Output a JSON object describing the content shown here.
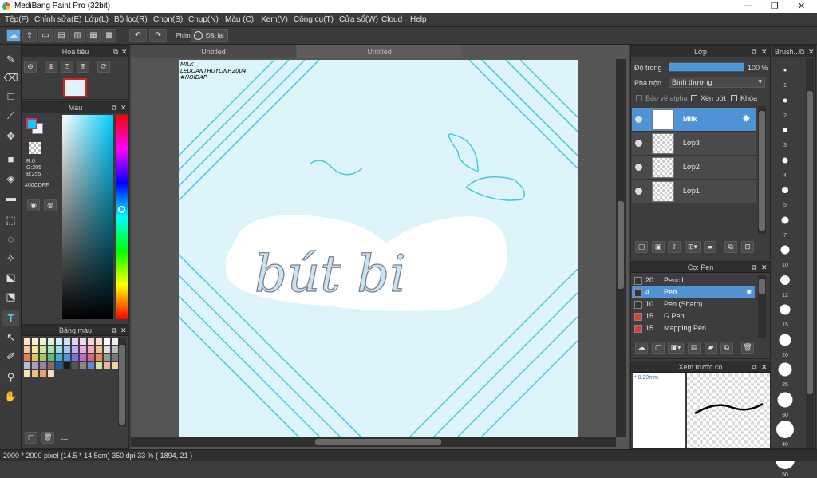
{
  "window": {
    "title": "MediBang Paint Pro (32bit)",
    "minimize": "—",
    "maximize": "❐",
    "close": "✕"
  },
  "menu": [
    "Tệp(F)",
    "Chỉnh sửa(E)",
    "Lớp(L)",
    "Bộ lọc(R)",
    "Chọn(S)",
    "Chụp(N)",
    "Màu (C)",
    "Xem(V)",
    "Công cụ(T)",
    "Cửa sổ(W)",
    "Cloud",
    "Help"
  ],
  "toolbar": {
    "phim_label": "Phím",
    "reset_label": "Đặt lại"
  },
  "navigator": {
    "title": "Hoa tiêu"
  },
  "color": {
    "title": "Màu",
    "r": "R:0",
    "g": "G:205",
    "b": "B:255",
    "hex": "#00CDFF",
    "primary": "#00CDFF"
  },
  "palette": {
    "title": "Bảng màu",
    "status": "---"
  },
  "canvas": {
    "tab1": "Untitled",
    "tab2": "Untitled",
    "doc_text": [
      "MILK",
      "LEDOANTHUYLINH2004",
      "#HOIDAP"
    ],
    "art_text": "bút bi"
  },
  "layers": {
    "title": "Lớp",
    "opacity_label": "Độ trong",
    "opacity_value": "100 %",
    "opacity_fraction": 1.0,
    "blend_label": "Pha trộn",
    "blend_value": "Bình thường",
    "protect_alpha": "Bảo vệ alpha",
    "clipping": "Xén bớt",
    "lock": "Khóa",
    "items": [
      {
        "name": "Milk",
        "selected": true
      },
      {
        "name": "Lớp3",
        "selected": false
      },
      {
        "name": "Lớp2",
        "selected": false
      },
      {
        "name": "Lớp1",
        "selected": false
      }
    ]
  },
  "brush": {
    "title": "Cọ: Pen",
    "items": [
      {
        "size": "20",
        "name": "Pencil",
        "color": "#333333",
        "selected": false
      },
      {
        "size": "4",
        "name": "Pen",
        "color": "#333333",
        "selected": true
      },
      {
        "size": "10",
        "name": "Pen (Sharp)",
        "color": "#333333",
        "selected": false
      },
      {
        "size": "15",
        "name": "G Pen",
        "color": "#e23a3a",
        "selected": false
      },
      {
        "size": "15",
        "name": "Mapping Pen",
        "color": "#e23a3a",
        "selected": false
      }
    ]
  },
  "preview": {
    "title": "Xem trước cọ",
    "size_label": "* 0.29mm"
  },
  "brush_sizes": {
    "title": "Brush...",
    "items": [
      "1",
      "2",
      "3",
      "4",
      "5",
      "7",
      "10",
      "12",
      "15",
      "20",
      "25",
      "30",
      "40",
      "50"
    ]
  },
  "status": {
    "text": "2000 * 2000 pixel   (14.5 * 14.5cm)   350 dpi   33 %   ( 1894, 21 )"
  }
}
